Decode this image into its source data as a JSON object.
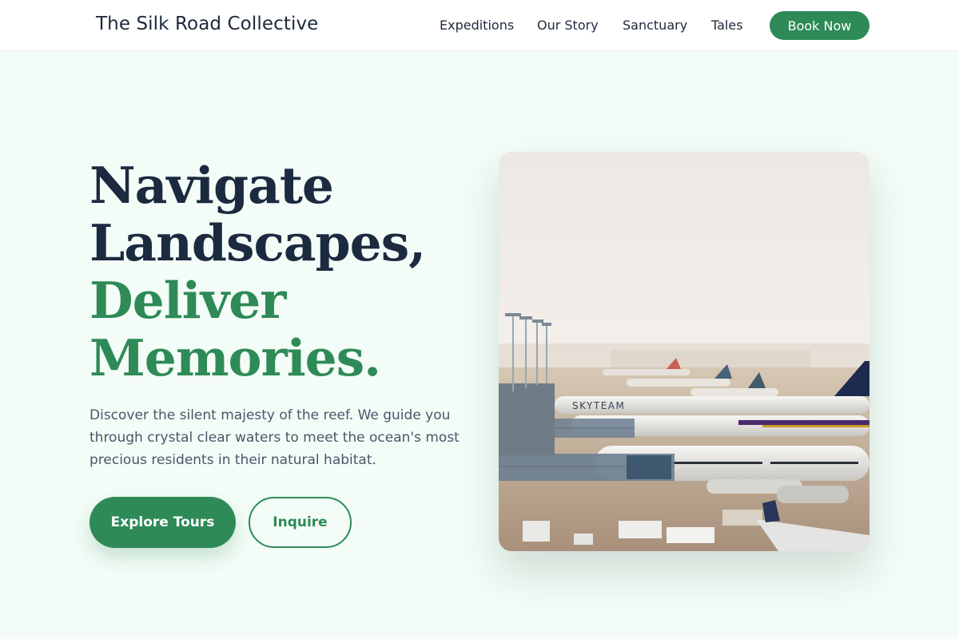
{
  "nav": {
    "brand": "The Silk Road Collective",
    "links": [
      "Expeditions",
      "Our Story",
      "Sanctuary",
      "Tales"
    ],
    "cta": "Book Now"
  },
  "hero": {
    "title_lines": [
      "Navigate",
      "Landscapes,",
      "Deliver",
      "Memories."
    ],
    "description": "Discover the silent majesty of the reef. We guide you through crystal clear waters to meet the ocean's most precious residents in their natural habitat.",
    "primary_cta": "Explore Tours",
    "secondary_cta": "Inquire",
    "image_label": "SKYTEAM"
  },
  "colors": {
    "accent": "#2e8a57",
    "heading": "#1b2a3f",
    "background": "#f3fcf7"
  }
}
